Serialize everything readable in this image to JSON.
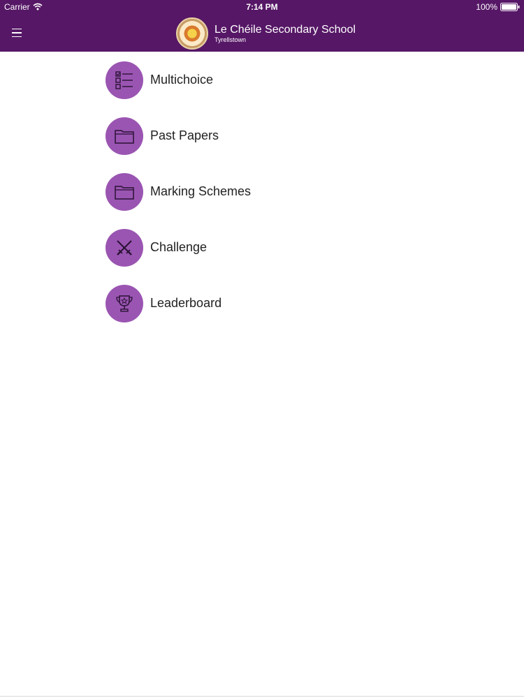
{
  "status_bar": {
    "carrier": "Carrier",
    "time": "7:14 PM",
    "battery": "100%"
  },
  "header": {
    "title": "Le Chéile Secondary School",
    "subtitle": "Tyrellstown",
    "background_color": "#561766",
    "menu_icon": "hamburger-menu-icon"
  },
  "menu": {
    "items": [
      {
        "label": "Multichoice",
        "icon": "checklist-icon"
      },
      {
        "label": "Past Papers",
        "icon": "folder-icon"
      },
      {
        "label": "Marking Schemes",
        "icon": "folder-icon"
      },
      {
        "label": "Challenge",
        "icon": "crossed-swords-icon"
      },
      {
        "label": "Leaderboard",
        "icon": "trophy-icon"
      }
    ],
    "icon_circle_color": "#9a55b2"
  }
}
